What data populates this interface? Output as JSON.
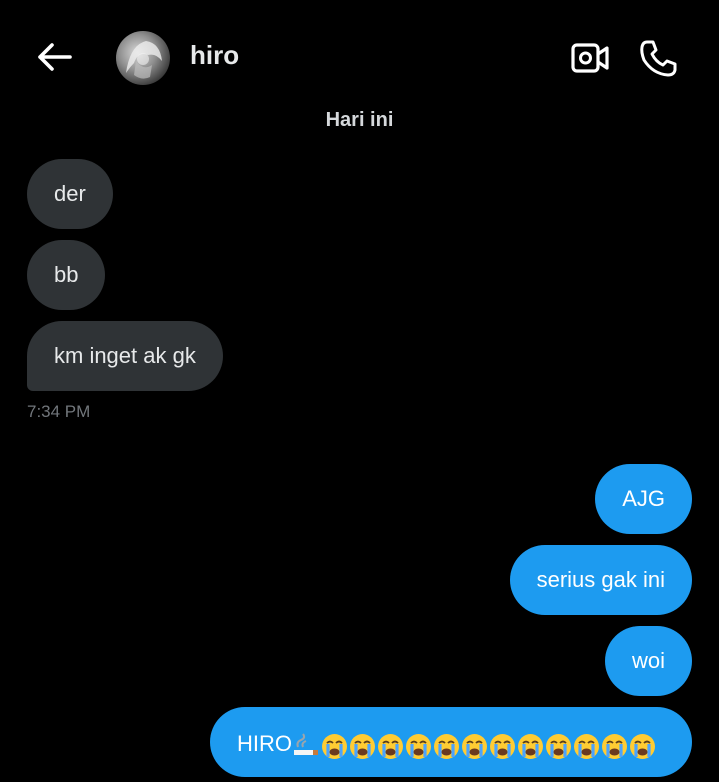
{
  "header": {
    "back_icon": "arrow-left-icon",
    "contact_name": "hiro",
    "video_icon": "video-camera-icon",
    "phone_icon": "phone-icon"
  },
  "date_separator": "Hari ini",
  "incoming": [
    {
      "text": "der"
    },
    {
      "text": "bb"
    },
    {
      "text": "km inget ak gk"
    }
  ],
  "incoming_time": "7:34 PM",
  "outgoing": [
    {
      "text": "AJG"
    },
    {
      "text": "serius gak ini"
    },
    {
      "text": "woi"
    },
    {
      "text": "HIRO",
      "emojis": [
        "smoking-icon",
        "loudly-crying-face",
        "loudly-crying-face",
        "loudly-crying-face",
        "loudly-crying-face",
        "loudly-crying-face",
        "loudly-crying-face",
        "loudly-crying-face",
        "loudly-crying-face",
        "loudly-crying-face",
        "loudly-crying-face",
        "loudly-crying-face",
        "loudly-crying-face"
      ]
    }
  ],
  "colors": {
    "background": "#000000",
    "incoming_bubble": "#2f3336",
    "outgoing_bubble": "#1d9bf0",
    "muted_text": "#71767b"
  }
}
